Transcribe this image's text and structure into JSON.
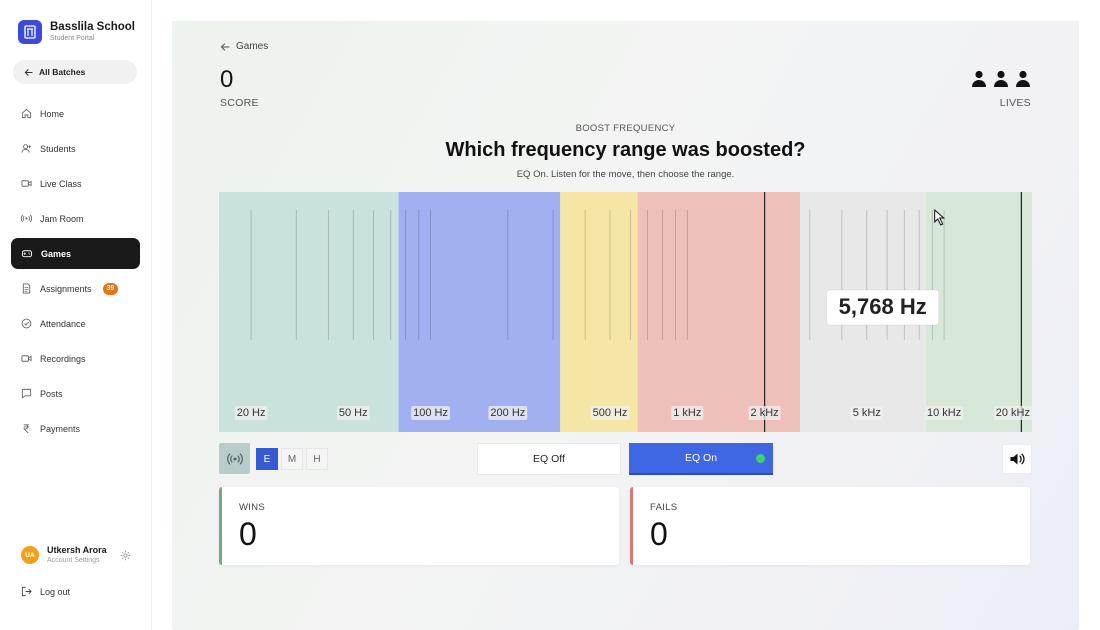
{
  "brand": {
    "name": "Basslila School",
    "subtitle": "Student Portal",
    "color": "#3b4bd8"
  },
  "sidebar": {
    "back_label": "All Batches",
    "items": [
      {
        "label": "Home",
        "icon": "home-icon"
      },
      {
        "label": "Students",
        "icon": "user-plus-icon"
      },
      {
        "label": "Live Class",
        "icon": "video-icon"
      },
      {
        "label": "Jam Room",
        "icon": "broadcast-icon"
      },
      {
        "label": "Games",
        "icon": "gamepad-icon",
        "active": true
      },
      {
        "label": "Assignments",
        "icon": "document-icon",
        "badge": "39"
      },
      {
        "label": "Attendance",
        "icon": "check-circle-icon"
      },
      {
        "label": "Recordings",
        "icon": "camera-icon"
      },
      {
        "label": "Posts",
        "icon": "message-icon"
      },
      {
        "label": "Payments",
        "icon": "rupee-icon"
      }
    ],
    "user": {
      "initials": "UA",
      "name": "Utkersh Arora",
      "subtitle": "Account Settings"
    },
    "logout_label": "Log out"
  },
  "game": {
    "breadcrumb": "Games",
    "score_value": "0",
    "score_label": "SCORE",
    "lives_count": 3,
    "lives_label": "LIVES",
    "mode_label": "BOOST FREQUENCY",
    "question": "Which frequency range was boosted?",
    "hint": "EQ On. Listen for the move, then choose the range."
  },
  "chart_data": {
    "type": "frequency-band-selector",
    "scale": "log",
    "x_range_hz": [
      15,
      22000
    ],
    "freq_labels": [
      {
        "hz": 20,
        "text": "20 Hz"
      },
      {
        "hz": 50,
        "text": "50 Hz"
      },
      {
        "hz": 100,
        "text": "100 Hz"
      },
      {
        "hz": 200,
        "text": "200 Hz"
      },
      {
        "hz": 500,
        "text": "500 Hz"
      },
      {
        "hz": 1000,
        "text": "1 kHz"
      },
      {
        "hz": 2000,
        "text": "2 kHz"
      },
      {
        "hz": 5000,
        "text": "5 kHz"
      },
      {
        "hz": 10000,
        "text": "10 kHz"
      },
      {
        "hz": 20000,
        "text": "20 kHz"
      }
    ],
    "bands": [
      {
        "from_hz": 15,
        "to_hz": 75,
        "color": "#c9e2dc"
      },
      {
        "from_hz": 75,
        "to_hz": 320,
        "color": "#a1b0f0"
      },
      {
        "from_hz": 320,
        "to_hz": 640,
        "color": "#f6e6a6"
      },
      {
        "from_hz": 640,
        "to_hz": 2750,
        "color": "#efc0ba"
      },
      {
        "from_hz": 2750,
        "to_hz": 8500,
        "color": "#e8e8e8"
      },
      {
        "from_hz": 8500,
        "to_hz": 22000,
        "color": "#d7e8d9"
      }
    ],
    "gridlines_hz": [
      20,
      30,
      40,
      50,
      60,
      70,
      80,
      90,
      100,
      200,
      300,
      400,
      500,
      600,
      700,
      800,
      900,
      1000,
      2000,
      3000,
      4000,
      5000,
      6000,
      7000,
      8000,
      9000,
      10000,
      20000
    ],
    "marker_lines_hz": [
      2000,
      20000
    ],
    "hover_frequency_label": "5,768 Hz",
    "hover_frequency_hz": 5768
  },
  "controls": {
    "range_options": [
      "E",
      "M",
      "H"
    ],
    "selected_range": "E",
    "eq_off_label": "EQ Off",
    "eq_on_label": "EQ On",
    "eq_on_active": true
  },
  "stats": {
    "wins_label": "WINS",
    "wins_value": "0",
    "fails_label": "FAILS",
    "fails_value": "0"
  }
}
